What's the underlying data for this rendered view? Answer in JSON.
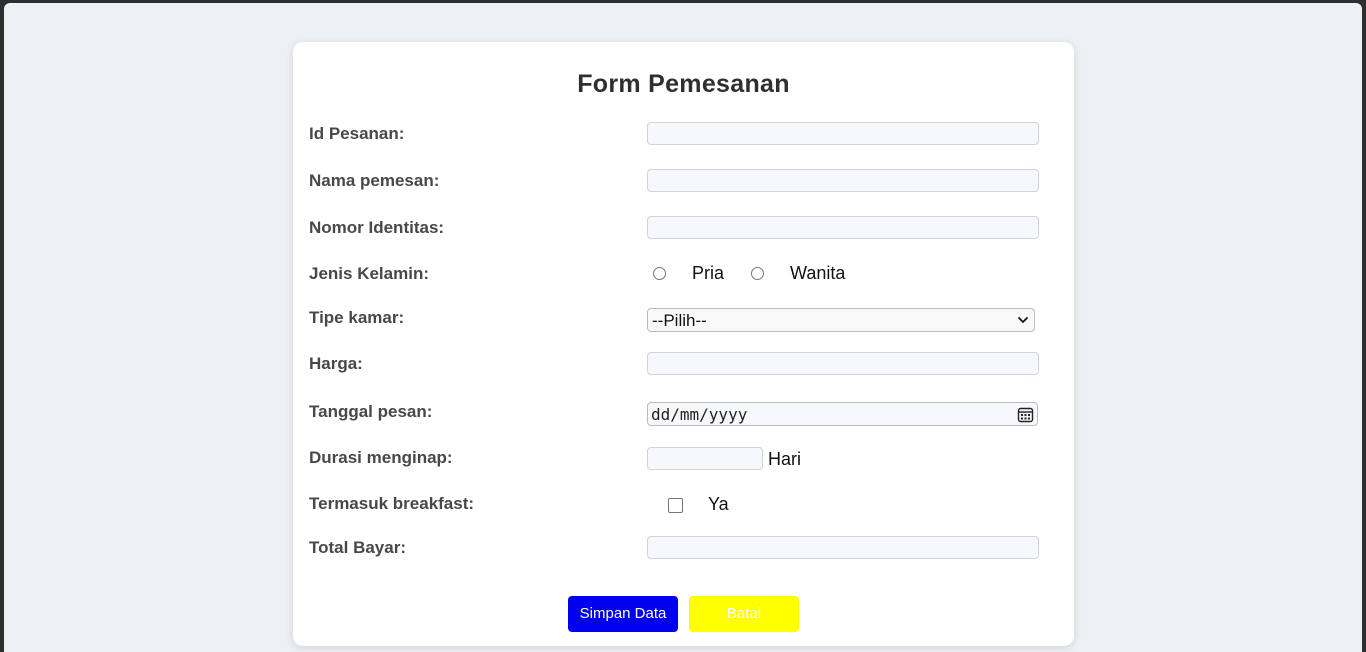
{
  "form": {
    "title": "Form Pemesanan",
    "labels": {
      "id_pesanan": "Id Pesanan:",
      "nama": "Nama pemesan:",
      "nomor": "Nomor Identitas:",
      "jenis_kelamin": "Jenis Kelamin:",
      "tipe_kamar": "Tipe kamar:",
      "harga": "Harga:",
      "tanggal": "Tanggal pesan:",
      "durasi": "Durasi menginap:",
      "breakfast": "Termasuk breakfast:",
      "total": "Total Bayar:"
    },
    "values": {
      "id_pesanan": "",
      "nama": "",
      "nomor": "",
      "harga": "",
      "durasi": "",
      "total": ""
    },
    "gender_options": [
      "Pria",
      "Wanita"
    ],
    "tipe_kamar_selected": "--Pilih--",
    "tanggal_placeholder": "dd/mm/yyyy",
    "durasi_unit": "Hari",
    "breakfast_option": "Ya",
    "buttons": {
      "save": "Simpan Data",
      "cancel": "Batal"
    }
  },
  "icons": {
    "select": "chevron-down-icon",
    "date": "calendar-icon"
  },
  "colors": {
    "save_button": "#0000ee",
    "cancel_button": "#ffff00",
    "page_background": "#edf0f4",
    "card_background": "#ffffff"
  }
}
